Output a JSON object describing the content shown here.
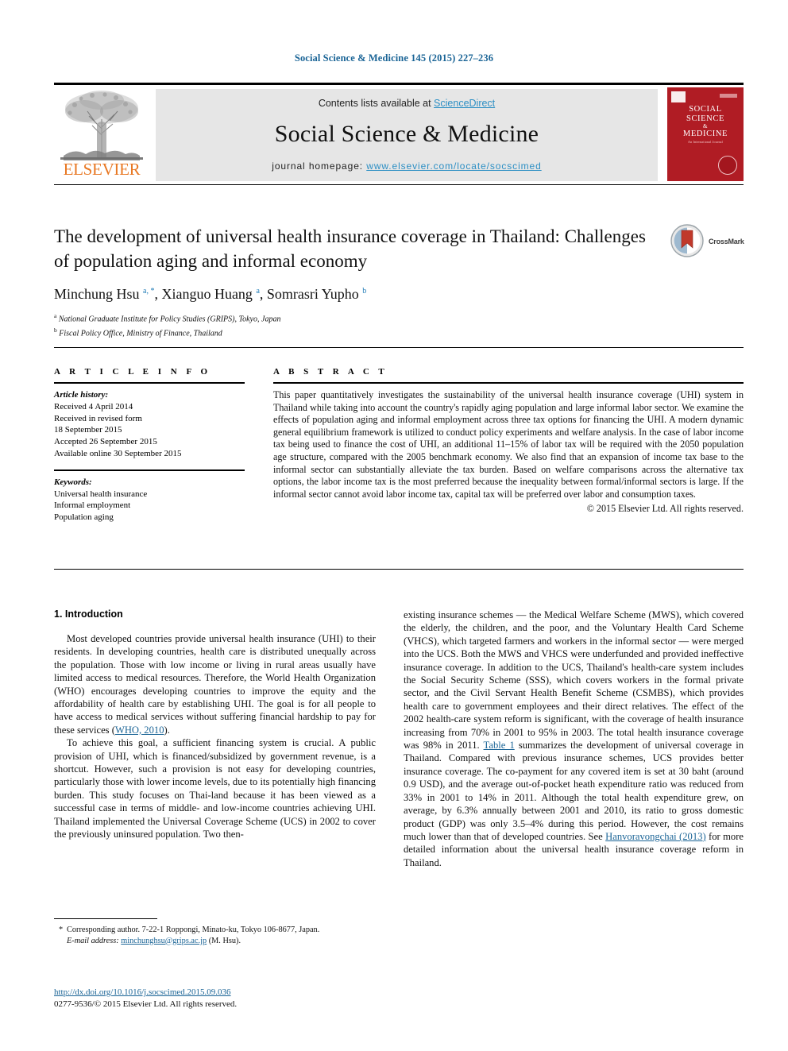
{
  "running_header": "Social Science & Medicine 145 (2015) 227–236",
  "masthead": {
    "contents_prefix": "Contents lists available at ",
    "contents_link": "ScienceDirect",
    "journal_name": "Social Science & Medicine",
    "homepage_prefix": "journal homepage: ",
    "homepage_url": "www.elsevier.com/locate/socscimed",
    "publisher_logo_text": "ELSEVIER",
    "cover": {
      "line1": "SOCIAL",
      "line2": "SCIENCE",
      "amp": "&",
      "line3": "MEDICINE",
      "subtitle": "An International Journal"
    },
    "accent_link_color": "#2d8fc4"
  },
  "article": {
    "title": "The development of universal health insurance coverage in Thailand: Challenges of population aging and informal economy",
    "authors_html": "Minchung Hsu <sup>a, *</sup>, Xianguo Huang <sup>a</sup>, Somrasri Yupho <sup>b</sup>",
    "affiliation_a": "National Graduate Institute for Policy Studies (GRIPS), Tokyo, Japan",
    "affiliation_b": "Fiscal Policy Office, Ministry of Finance, Thailand",
    "crossmark_label": "CrossMark"
  },
  "article_info": {
    "kicker": "A R T I C L E  I N F O",
    "history_heading": "Article history:",
    "history_lines": [
      "Received 4 April 2014",
      "Received in revised form",
      "18 September 2015",
      "Accepted 26 September 2015",
      "Available online 30 September 2015"
    ],
    "keywords_heading": "Keywords:",
    "keywords": [
      "Universal health insurance",
      "Informal employment",
      "Population aging"
    ]
  },
  "abstract": {
    "kicker": "A B S T R A C T",
    "text": "This paper quantitatively investigates the sustainability of the universal health insurance coverage (UHI) system in Thailand while taking into account the country's rapidly aging population and large informal labor sector. We examine the effects of population aging and informal employment across three tax options for financing the UHI. A modern dynamic general equilibrium framework is utilized to conduct policy experiments and welfare analysis. In the case of labor income tax being used to finance the cost of UHI, an additional 11–15% of labor tax will be required with the 2050 population age structure, compared with the 2005 benchmark economy. We also find that an expansion of income tax base to the informal sector can substantially alleviate the tax burden. Based on welfare comparisons across the alternative tax options, the labor income tax is the most preferred because the inequality between formal/informal sectors is large. If the informal sector cannot avoid labor income tax, capital tax will be preferred over labor and consumption taxes.",
    "copyright": "© 2015 Elsevier Ltd. All rights reserved."
  },
  "body": {
    "section_heading": "1. Introduction",
    "left_paragraph_1_a": "Most developed countries provide universal health insurance (UHI) to their residents. In developing countries, health care is distributed unequally across the population. Those with low income or living in rural areas usually have limited access to medical resources. Therefore, the World Health Organization (WHO) encourages developing countries to improve the equity and the affordability of health care by establishing UHI. The goal is for all people to have access to medical services without suffering financial hardship to pay for these services (",
    "left_paragraph_1_link": "WHO, 2010",
    "left_paragraph_1_b": ").",
    "left_paragraph_2": "To achieve this goal, a sufficient financing system is crucial. A public provision of UHI, which is financed/subsidized by government revenue, is a shortcut. However, such a provision is not easy for developing countries, particularly those with lower income levels, due to its potentially high financing burden. This study focuses on Thai-land because it has been viewed as a successful case in terms of middle- and low-income countries achieving UHI. Thailand implemented the Universal Coverage Scheme (UCS) in 2002 to cover the previously uninsured population. Two then-",
    "right_paragraph_a": "existing insurance schemes — the Medical Welfare Scheme (MWS), which covered the elderly, the children, and the poor, and the Voluntary Health Card Scheme (VHCS), which targeted farmers and workers in the informal sector — were merged into the UCS. Both the MWS and VHCS were underfunded and provided ineffective insurance coverage. In addition to the UCS, Thailand's health-care system includes the Social Security Scheme (SSS), which covers workers in the formal private sector, and the Civil Servant Health Benefit Scheme (CSMBS), which provides health care to government employees and their direct relatives. The effect of the 2002 health-care system reform is significant, with the coverage of health insurance increasing from 70% in 2001 to 95% in 2003. The total health insurance coverage was 98% in 2011. ",
    "right_link_1": "Table 1",
    "right_paragraph_b": " summarizes the development of universal coverage in Thailand. Compared with previous insurance schemes, UCS provides better insurance coverage. The co-payment for any covered item is set at 30 baht (around 0.9 USD), and the average out-of-pocket heath expenditure ratio was reduced from 33% in 2001 to 14% in 2011. Although the total health expenditure grew, on average, by 6.3% annually between 2001 and 2010, its ratio to gross domestic product (GDP) was only 3.5–4% during this period. However, the cost remains much lower than that of developed countries. See ",
    "right_link_2": "Hanvoravongchai (2013)",
    "right_paragraph_c": " for more detailed information about the universal health insurance coverage reform in Thailand."
  },
  "footnote": {
    "marker": "*",
    "corresponding": "Corresponding author. 7-22-1 Roppongi, Minato-ku, Tokyo 106-8677, Japan.",
    "email_label": "E-mail address:",
    "email": "minchunghsu@grips.ac.jp",
    "email_suffix": " (M. Hsu)."
  },
  "footer": {
    "doi": "http://dx.doi.org/10.1016/j.socscimed.2015.09.036",
    "issn_line": "0277-9536/© 2015 Elsevier Ltd. All rights reserved."
  }
}
